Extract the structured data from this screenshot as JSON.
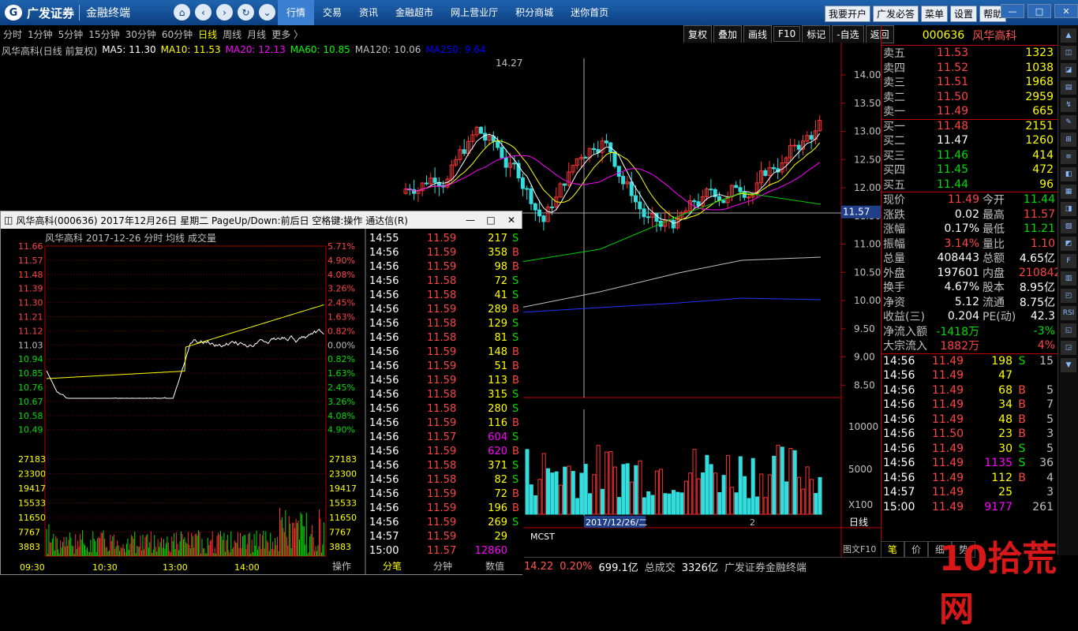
{
  "app": {
    "logo": "广发证券",
    "sub": "金融终端",
    "nav": [
      "行情",
      "交易",
      "资讯",
      "金融超市",
      "网上营业厅",
      "积分商城",
      "迷你首页"
    ],
    "topbtns": [
      "我要开户",
      "广发必答",
      "菜单",
      "设置",
      "帮助"
    ]
  },
  "periods": [
    "分时",
    "1分钟",
    "5分钟",
    "15分钟",
    "30分钟",
    "60分钟",
    "日线",
    "周线",
    "月线",
    "更多 〉"
  ],
  "tools": [
    "复权",
    "叠加",
    "画线",
    "F10",
    "标记",
    "-自选",
    "返回"
  ],
  "legend": {
    "title": "风华高科(日线 前复权)",
    "ma": [
      "MA5: 11.30",
      "MA10: 11.53",
      "MA20: 12.13",
      "MA60: 10.85",
      "MA120: 10.06",
      "MA250: 9.64"
    ]
  },
  "price_axis": [
    "14.00",
    "13.50",
    "13.00",
    "12.50",
    "12.00",
    "11.50",
    "11.00",
    "10.50",
    "10.00",
    "9.50",
    "9.00",
    "8.50"
  ],
  "vol_axis": [
    "10000",
    "5000",
    "X100"
  ],
  "high_label": "14.27",
  "cur_label": "11.57",
  "date_label": "2017/12/26/二",
  "bottom_right": "日线",
  "bottom_left": "MCST",
  "f10": "图文F10",
  "bottom_mark": "2",
  "stock": {
    "code": "000636",
    "name": "风华高科"
  },
  "orderbook": [
    [
      "卖五",
      "11.53",
      "1323"
    ],
    [
      "卖四",
      "11.52",
      "1038"
    ],
    [
      "卖三",
      "11.51",
      "1968"
    ],
    [
      "卖二",
      "11.50",
      "2959"
    ],
    [
      "卖一",
      "11.49",
      "665"
    ],
    [
      "买一",
      "11.48",
      "2151"
    ],
    [
      "买二",
      "11.47",
      "1260"
    ],
    [
      "买三",
      "11.46",
      "414"
    ],
    [
      "买四",
      "11.45",
      "472"
    ],
    [
      "买五",
      "11.44",
      "96"
    ]
  ],
  "stats": [
    [
      "现价",
      "11.49",
      "今开",
      "11.44"
    ],
    [
      "涨跌",
      "0.02",
      "最高",
      "11.57"
    ],
    [
      "涨幅",
      "0.17%",
      "最低",
      "11.21"
    ],
    [
      "振幅",
      "3.14%",
      "量比",
      "1.10"
    ],
    [
      "总量",
      "408443",
      "总额",
      "4.65亿"
    ],
    [
      "外盘",
      "197601",
      "内盘",
      "210842"
    ],
    [
      "换手",
      "4.67%",
      "股本",
      "8.95亿"
    ],
    [
      "净资",
      "5.12",
      "流通",
      "8.75亿"
    ],
    [
      "收益(三)",
      "0.204",
      "PE(动)",
      "42.3"
    ],
    [
      "净流入额",
      "-1418万",
      "",
      "-3%"
    ],
    [
      "大宗流入",
      "1882万",
      "",
      "4%"
    ]
  ],
  "ticks_right": [
    [
      "14:56",
      "11.49",
      "198",
      "S",
      "15"
    ],
    [
      "14:56",
      "11.49",
      "47",
      "",
      ""
    ],
    [
      "14:56",
      "11.49",
      "68",
      "B",
      "5"
    ],
    [
      "14:56",
      "11.49",
      "34",
      "B",
      "7"
    ],
    [
      "14:56",
      "11.49",
      "48",
      "B",
      "5"
    ],
    [
      "14:56",
      "11.50",
      "23",
      "B",
      "3"
    ],
    [
      "14:56",
      "11.49",
      "30",
      "S",
      "5"
    ],
    [
      "14:56",
      "11.49",
      "1135",
      "S",
      "36"
    ],
    [
      "14:56",
      "11.49",
      "112",
      "B",
      "4"
    ],
    [
      "14:57",
      "11.49",
      "25",
      "",
      "3"
    ],
    [
      "15:00",
      "11.49",
      "9177",
      "",
      "261"
    ]
  ],
  "righttabs": [
    "笔",
    "价",
    "细",
    "势"
  ],
  "status": {
    "v1": "14.22",
    "v2": "0.20%",
    "v3": "699.1亿",
    "l4": "总成交",
    "v4": "3326亿",
    "l5": "广发证券金融终端"
  },
  "popup": {
    "title": "风华高科(000636) 2017年12月26日 星期二 PageUp/Down:前后日 空格键:操作 通达信(R)",
    "sub": "风华高科   2017-12-26 分时 均线 成交量",
    "left_axis": [
      "11.66",
      "11.57",
      "11.48",
      "11.39",
      "11.30",
      "11.21",
      "11.12",
      "11.03",
      "10.94",
      "10.85",
      "10.76",
      "10.67",
      "10.58",
      "10.49",
      "27183",
      "23300",
      "19417",
      "15533",
      "11650",
      "7767",
      "3883"
    ],
    "pct_axis": [
      "5.71%",
      "4.90%",
      "4.08%",
      "3.26%",
      "2.45%",
      "1.63%",
      "0.82%",
      "0.00%",
      "0.82%",
      "1.63%",
      "2.45%",
      "3.26%",
      "4.08%",
      "4.90%"
    ],
    "times": [
      "09:30",
      "10:30",
      "13:00",
      "14:00"
    ],
    "ticks": [
      [
        "14:55",
        "11.59",
        "217",
        "S"
      ],
      [
        "14:56",
        "11.59",
        "358",
        "B"
      ],
      [
        "14:56",
        "11.59",
        "98",
        "B"
      ],
      [
        "14:56",
        "11.58",
        "72",
        "S"
      ],
      [
        "14:56",
        "11.58",
        "41",
        "S"
      ],
      [
        "14:56",
        "11.59",
        "289",
        "B"
      ],
      [
        "14:56",
        "11.58",
        "129",
        "S"
      ],
      [
        "14:56",
        "11.58",
        "81",
        "S"
      ],
      [
        "14:56",
        "11.59",
        "148",
        "B"
      ],
      [
        "14:56",
        "11.59",
        "51",
        "B"
      ],
      [
        "14:56",
        "11.59",
        "113",
        "B"
      ],
      [
        "14:56",
        "11.58",
        "315",
        "S"
      ],
      [
        "14:56",
        "11.58",
        "280",
        "S"
      ],
      [
        "14:56",
        "11.59",
        "116",
        "B"
      ],
      [
        "14:56",
        "11.57",
        "604",
        "S"
      ],
      [
        "14:56",
        "11.59",
        "620",
        "B"
      ],
      [
        "14:56",
        "11.58",
        "371",
        "S"
      ],
      [
        "14:56",
        "11.58",
        "82",
        "S"
      ],
      [
        "14:56",
        "11.59",
        "72",
        "B"
      ],
      [
        "14:56",
        "11.59",
        "196",
        "B"
      ],
      [
        "14:56",
        "11.59",
        "269",
        "S"
      ],
      [
        "14:57",
        "11.59",
        "29",
        ""
      ],
      [
        "15:00",
        "11.57",
        "12860",
        ""
      ]
    ],
    "tabs": [
      "操作",
      "分笔",
      "分钟",
      "数值"
    ]
  },
  "watermark": "10拾荒网"
}
